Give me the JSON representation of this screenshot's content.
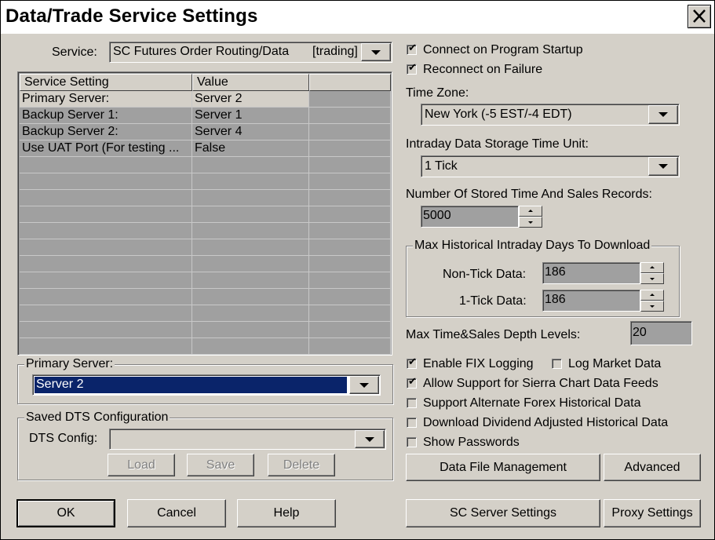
{
  "window": {
    "title": "Data/Trade Service Settings",
    "close_icon": "close-icon"
  },
  "service": {
    "label": "Service:",
    "name": "SC Futures Order Routing/Data",
    "tag": "[trading]"
  },
  "grid": {
    "headers": [
      "Service Setting",
      "Value"
    ],
    "rows": [
      {
        "setting": "Primary Server:",
        "value": "Server 2"
      },
      {
        "setting": "Backup Server 1:",
        "value": "Server 1"
      },
      {
        "setting": "Backup Server 2:",
        "value": "Server 4"
      },
      {
        "setting": "Use UAT Port (For testing ...",
        "value": "False"
      }
    ]
  },
  "primary_server": {
    "legend": "Primary Server:",
    "value": "Server 2",
    "highlight": "#0a246a"
  },
  "dts": {
    "legend": "Saved DTS Configuration",
    "label": "DTS Config:",
    "value": "",
    "load": "Load",
    "save": "Save",
    "delete": "Delete"
  },
  "options": {
    "connect_on_startup": {
      "label": "Connect on Program Startup",
      "checked": true
    },
    "reconnect_on_failure": {
      "label": "Reconnect on Failure",
      "checked": true
    },
    "enable_fix_logging": {
      "label": "Enable FIX Logging",
      "checked": true
    },
    "log_market_data": {
      "label": "Log Market Data",
      "checked": false
    },
    "allow_sc_data_feeds": {
      "label": "Allow Support for Sierra Chart Data Feeds",
      "checked": true
    },
    "alternate_forex": {
      "label": "Support Alternate Forex Historical Data",
      "checked": false
    },
    "dividend_adjusted": {
      "label": "Download Dividend Adjusted Historical Data",
      "checked": false
    },
    "show_passwords": {
      "label": "Show Passwords",
      "checked": false
    }
  },
  "time_zone": {
    "label": "Time Zone:",
    "value": "New York (-5 EST/-4 EDT)"
  },
  "storage_unit": {
    "label": "Intraday Data Storage Time Unit:",
    "value": "1 Tick"
  },
  "ts_records": {
    "label": "Number Of Stored Time And Sales Records:",
    "value": "5000"
  },
  "max_days": {
    "legend": "Max Historical Intraday Days To Download",
    "non_tick_label": "Non-Tick Data:",
    "non_tick_value": "186",
    "tick_label": "1-Tick Data:",
    "tick_value": "186"
  },
  "depth": {
    "label": "Max Time&Sales Depth Levels:",
    "value": "20"
  },
  "buttons": {
    "data_file_management": "Data File Management",
    "advanced": "Advanced",
    "ok": "OK",
    "cancel": "Cancel",
    "help": "Help",
    "sc_server_settings": "SC Server Settings",
    "proxy_settings": "Proxy Settings"
  }
}
